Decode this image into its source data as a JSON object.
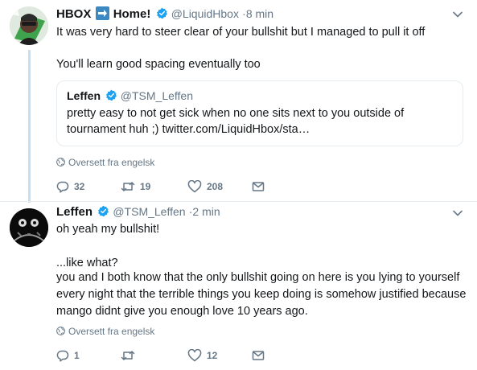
{
  "tweets": [
    {
      "name": "HBOX",
      "name_suffix": "Home!",
      "handle": "@LiquidHbox",
      "dot": "·",
      "time": "8 min",
      "text_line1": "It was very hard to steer clear of your bullshit but I managed to pull it off",
      "text_line2": "You'll learn good spacing eventually too",
      "quote": {
        "name": "Leffen",
        "handle": "@TSM_Leffen",
        "text": "pretty easy to not get sick when no one sits next to you outside of tournament huh ;) twitter.com/LiquidHbox/sta…"
      },
      "translate": "Oversett fra engelsk",
      "replies": "32",
      "retweets": "19",
      "likes": "208"
    },
    {
      "name": "Leffen",
      "handle": "@TSM_Leffen",
      "dot": "·",
      "time": "2 min",
      "text_line1": "oh yeah my bullshit!",
      "text_line2": "...like what?",
      "text_line3": "you and I both know that the only bullshit going on here is you lying to yourself every night that the terrible things you keep doing is somehow justified because mango didnt give you enough love 10 years ago.",
      "translate": "Oversett fra engelsk",
      "replies": "1",
      "retweets": "",
      "likes": "12"
    }
  ],
  "icons": {
    "reply": "reply-icon",
    "retweet": "retweet-icon",
    "like": "heart-icon",
    "dm": "envelope-icon",
    "verified": "verified-badge-icon",
    "caret": "chevron-down-icon",
    "globe": "globe-icon",
    "arrow_emoji": "right-arrow-emoji-icon"
  },
  "colors": {
    "text": "#14171a",
    "secondary": "#657786",
    "verified": "#1da1f2",
    "thread_line": "#c4dff3",
    "border": "#e6ecf0"
  }
}
